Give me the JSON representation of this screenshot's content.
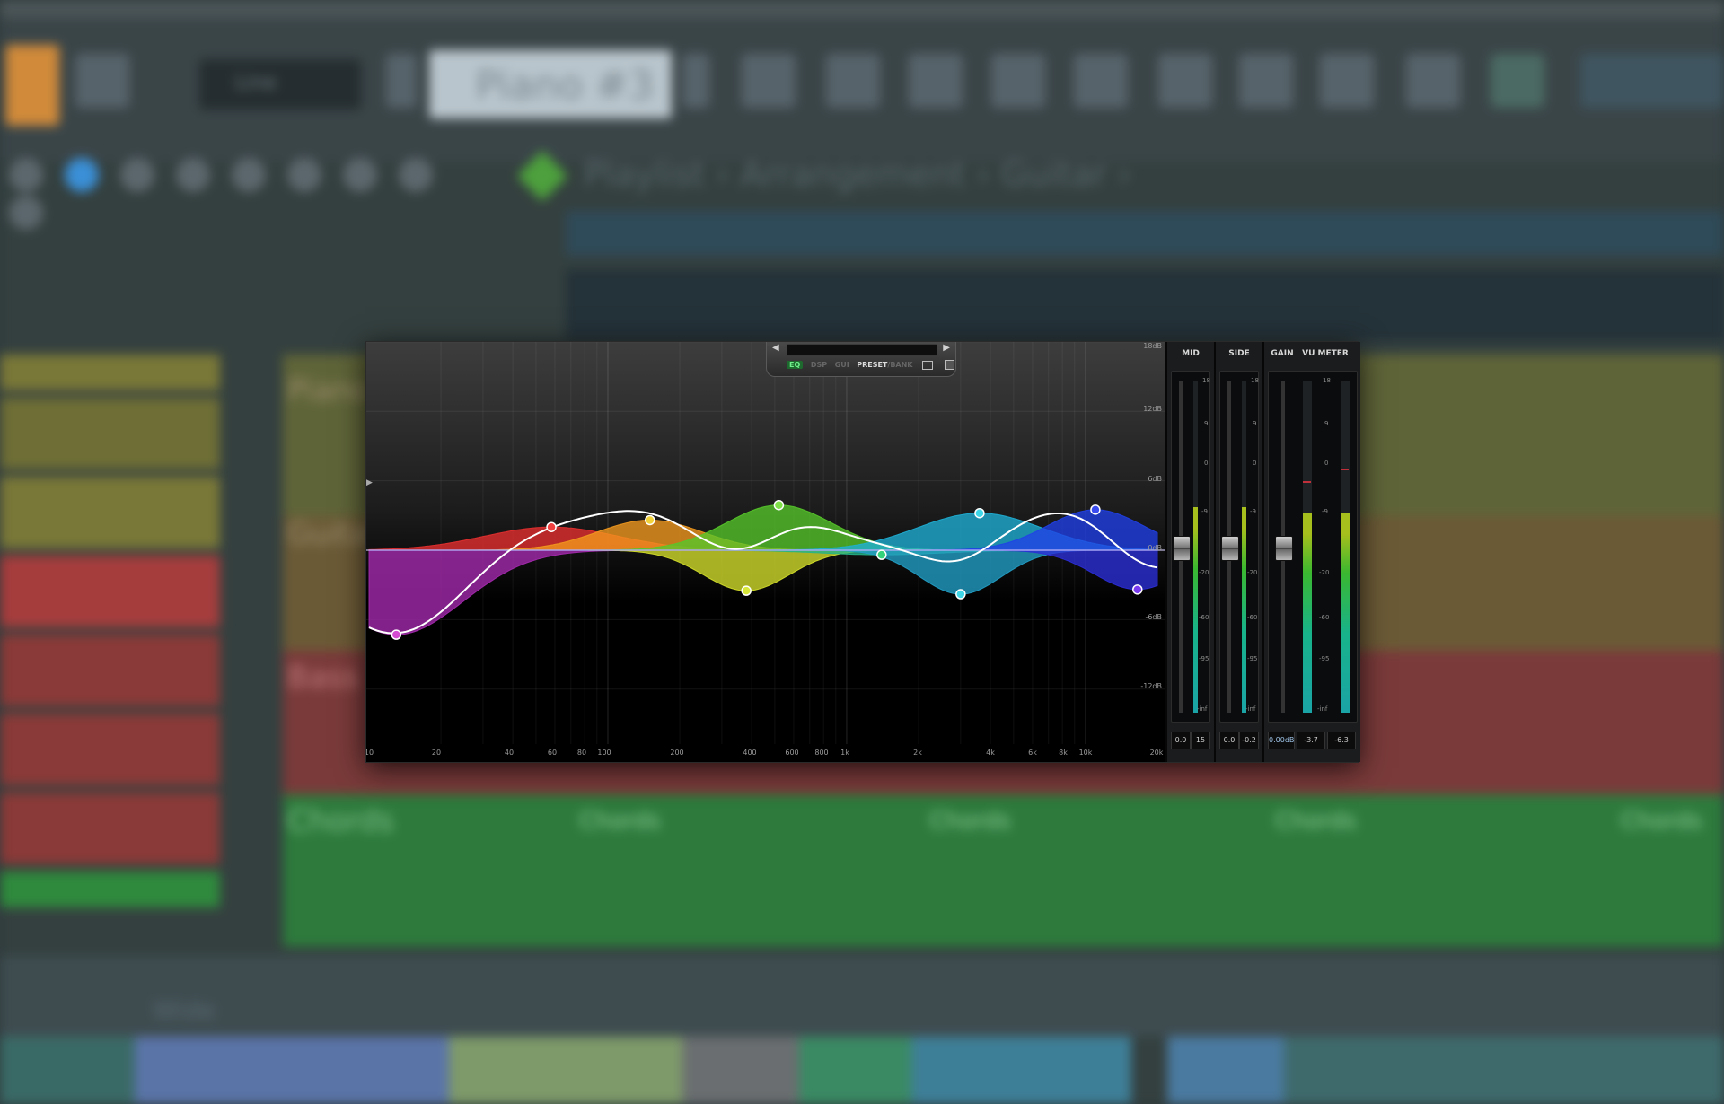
{
  "background_daw": {
    "pattern_name": "Piano #3",
    "line_select": "Line",
    "breadcrumb": "Playlist › Arrangement › Guitar ›",
    "track_labels": [
      "Piano",
      "Guitar",
      "Bass",
      "Chords"
    ],
    "clip_labels": [
      "Chords",
      "Chords",
      "Chords",
      "Chords"
    ],
    "bottom_label": "Wide"
  },
  "eq_plugin": {
    "tabs": [
      "EQ",
      "DSP",
      "GUI",
      "PRESET",
      "BANK"
    ],
    "active_tab": "EQ",
    "db_labels": [
      "18dB",
      "12dB",
      "6dB",
      "0dB",
      "-6dB",
      "-12dB"
    ],
    "freq_labels": [
      "10",
      "20",
      "40",
      "60",
      "80",
      "100",
      "200",
      "400",
      "600",
      "800",
      "1k",
      "2k",
      "4k",
      "6k",
      "8k",
      "10k",
      "20k"
    ],
    "band_nodes": [
      {
        "color": "#d44ad0",
        "freq_hz": 13,
        "gain_db": -7.3
      },
      {
        "color": "#f04040",
        "freq_hz": 58,
        "gain_db": 2.0
      },
      {
        "color": "#f2d23a",
        "freq_hz": 150,
        "gain_db": 2.6
      },
      {
        "color": "#d8e83a",
        "freq_hz": 380,
        "gain_db": -3.5
      },
      {
        "color": "#7fe04a",
        "freq_hz": 520,
        "gain_db": 3.9
      },
      {
        "color": "#34d27a",
        "freq_hz": 1400,
        "gain_db": -0.4
      },
      {
        "color": "#3fd6e8",
        "freq_hz": 3600,
        "gain_db": 3.2
      },
      {
        "color": "#3fd6e8",
        "freq_hz": 3000,
        "gain_db": -3.8
      },
      {
        "color": "#3a4cf0",
        "freq_hz": 11000,
        "gain_db": 3.5
      },
      {
        "color": "#7a3af0",
        "freq_hz": 16500,
        "gain_db": -3.4
      }
    ]
  },
  "meters": {
    "mid": {
      "title": "MID",
      "values": [
        "0.0",
        "15"
      ],
      "scale": [
        "18",
        "9",
        "0",
        "-9",
        "-20",
        "-60",
        "-95",
        "-inf"
      ],
      "level": 0.62
    },
    "side": {
      "title": "SIDE",
      "values": [
        "0.0",
        "-0.2"
      ],
      "scale": [
        "18",
        "9",
        "0",
        "-9",
        "-20",
        "-60",
        "-95",
        "-inf"
      ],
      "level": 0.62
    },
    "gain": {
      "title": "GAIN",
      "values": [
        "0.00dB"
      ],
      "level": 0.5
    },
    "vu": {
      "title": "VU METER",
      "values": [
        "-3.7",
        "-6.3"
      ],
      "scale": [
        "18",
        "9",
        "0",
        "-9",
        "-20",
        "-60",
        "-95",
        "-inf"
      ],
      "levels": [
        0.6,
        0.6
      ]
    }
  }
}
